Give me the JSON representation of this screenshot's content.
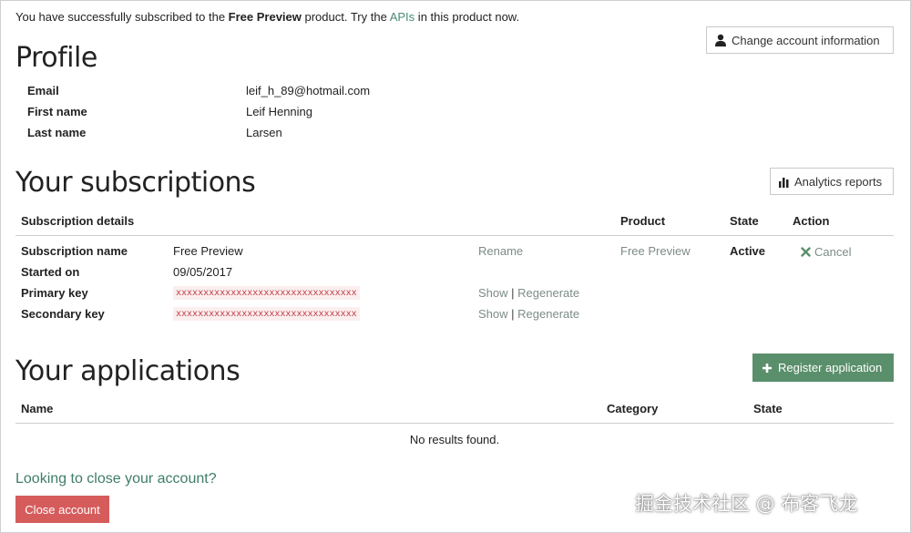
{
  "notice": {
    "prefix": "You have successfully subscribed to the ",
    "product": "Free Preview",
    "middle": " product. Try the ",
    "apis_link": "APIs",
    "suffix": " in this product now."
  },
  "profile": {
    "title": "Profile",
    "change_button": "Change account information",
    "fields": [
      {
        "label": "Email",
        "value": "leif_h_89@hotmail.com"
      },
      {
        "label": "First name",
        "value": "Leif Henning"
      },
      {
        "label": "Last name",
        "value": "Larsen"
      }
    ]
  },
  "subscriptions": {
    "title": "Your subscriptions",
    "analytics_button": "Analytics reports",
    "headers": {
      "details": "Subscription details",
      "product": "Product",
      "state": "State",
      "action": "Action"
    },
    "rows": [
      {
        "label": "Subscription name",
        "value": "Free Preview"
      },
      {
        "label": "Started on",
        "value": "09/05/2017"
      },
      {
        "label": "Primary key",
        "value": "xxxxxxxxxxxxxxxxxxxxxxxxxxxxxxxxx"
      },
      {
        "label": "Secondary key",
        "value": "xxxxxxxxxxxxxxxxxxxxxxxxxxxxxxxxx"
      }
    ],
    "rename": "Rename",
    "show": "Show",
    "separator": "|",
    "regenerate": "Regenerate",
    "product_value": "Free Preview",
    "state_value": "Active",
    "cancel": "Cancel"
  },
  "applications": {
    "title": "Your applications",
    "register_button": "Register application",
    "headers": {
      "name": "Name",
      "category": "Category",
      "state": "State"
    },
    "empty": "No results found."
  },
  "close_account": {
    "prompt": "Looking to close your account?",
    "button": "Close account"
  },
  "watermark": "掘金技术社区 @ 布客飞龙",
  "colors": {
    "accent_green": "#5a8f6b",
    "danger": "#d65c5c",
    "link": "#4a8a73",
    "key_text": "#c0404a"
  }
}
